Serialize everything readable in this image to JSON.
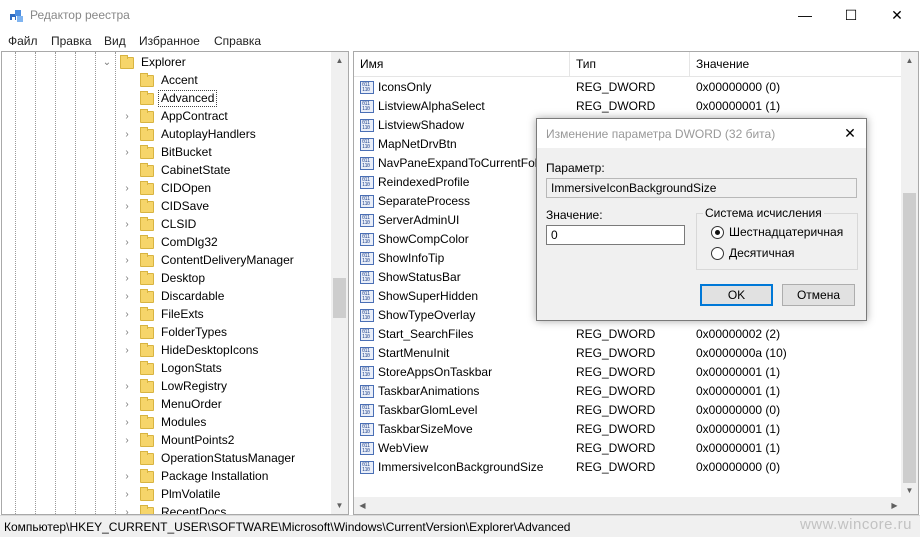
{
  "window": {
    "title": "Редактор реестра",
    "minimize": "—",
    "maximize": "☐",
    "close": "✕"
  },
  "menu": [
    "Файл",
    "Правка",
    "Вид",
    "Избранное",
    "Справка"
  ],
  "tree": {
    "parent": "Explorer",
    "selected": "Advanced",
    "items": [
      {
        "label": "Explorer",
        "expander": "⌄"
      },
      {
        "label": "Accent",
        "expander": ""
      },
      {
        "label": "Advanced",
        "expander": ""
      },
      {
        "label": "AppContract",
        "expander": "›"
      },
      {
        "label": "AutoplayHandlers",
        "expander": "›"
      },
      {
        "label": "BitBucket",
        "expander": "›"
      },
      {
        "label": "CabinetState",
        "expander": ""
      },
      {
        "label": "CIDOpen",
        "expander": "›"
      },
      {
        "label": "CIDSave",
        "expander": "›"
      },
      {
        "label": "CLSID",
        "expander": "›"
      },
      {
        "label": "ComDlg32",
        "expander": "›"
      },
      {
        "label": "ContentDeliveryManager",
        "expander": "›"
      },
      {
        "label": "Desktop",
        "expander": "›"
      },
      {
        "label": "Discardable",
        "expander": "›"
      },
      {
        "label": "FileExts",
        "expander": "›"
      },
      {
        "label": "FolderTypes",
        "expander": "›"
      },
      {
        "label": "HideDesktopIcons",
        "expander": "›"
      },
      {
        "label": "LogonStats",
        "expander": ""
      },
      {
        "label": "LowRegistry",
        "expander": "›"
      },
      {
        "label": "MenuOrder",
        "expander": "›"
      },
      {
        "label": "Modules",
        "expander": "›"
      },
      {
        "label": "MountPoints2",
        "expander": "›"
      },
      {
        "label": "OperationStatusManager",
        "expander": ""
      },
      {
        "label": "Package Installation",
        "expander": "›"
      },
      {
        "label": "PlmVolatile",
        "expander": "›"
      },
      {
        "label": "RecentDocs",
        "expander": "›"
      }
    ]
  },
  "list": {
    "headers": {
      "name": "Имя",
      "type": "Тип",
      "value": "Значение"
    },
    "rows": [
      {
        "name": "IconsOnly",
        "type": "REG_DWORD",
        "value": "0x00000000 (0)"
      },
      {
        "name": "ListviewAlphaSelect",
        "type": "REG_DWORD",
        "value": "0x00000001 (1)"
      },
      {
        "name": "ListviewShadow",
        "type": "",
        "value": ""
      },
      {
        "name": "MapNetDrvBtn",
        "type": "",
        "value": ""
      },
      {
        "name": "NavPaneExpandToCurrentFolder",
        "type": "",
        "value": ""
      },
      {
        "name": "ReindexedProfile",
        "type": "",
        "value": ""
      },
      {
        "name": "SeparateProcess",
        "type": "",
        "value": ""
      },
      {
        "name": "ServerAdminUI",
        "type": "",
        "value": ""
      },
      {
        "name": "ShowCompColor",
        "type": "",
        "value": ""
      },
      {
        "name": "ShowInfoTip",
        "type": "",
        "value": ""
      },
      {
        "name": "ShowStatusBar",
        "type": "",
        "value": ""
      },
      {
        "name": "ShowSuperHidden",
        "type": "",
        "value": ""
      },
      {
        "name": "ShowTypeOverlay",
        "type": "",
        "value": ""
      },
      {
        "name": "Start_SearchFiles",
        "type": "REG_DWORD",
        "value": "0x00000002 (2)"
      },
      {
        "name": "StartMenuInit",
        "type": "REG_DWORD",
        "value": "0x0000000a (10)"
      },
      {
        "name": "StoreAppsOnTaskbar",
        "type": "REG_DWORD",
        "value": "0x00000001 (1)"
      },
      {
        "name": "TaskbarAnimations",
        "type": "REG_DWORD",
        "value": "0x00000001 (1)"
      },
      {
        "name": "TaskbarGlomLevel",
        "type": "REG_DWORD",
        "value": "0x00000000 (0)"
      },
      {
        "name": "TaskbarSizeMove",
        "type": "REG_DWORD",
        "value": "0x00000001 (1)"
      },
      {
        "name": "WebView",
        "type": "REG_DWORD",
        "value": "0x00000001 (1)"
      },
      {
        "name": "ImmersiveIconBackgroundSize",
        "type": "REG_DWORD",
        "value": "0x00000000 (0)"
      }
    ]
  },
  "status": {
    "path": "Компьютер\\HKEY_CURRENT_USER\\SOFTWARE\\Microsoft\\Windows\\CurrentVersion\\Explorer\\Advanced",
    "watermark": "www.wincore.ru"
  },
  "dialog": {
    "title": "Изменение параметра DWORD (32 бита)",
    "close": "✕",
    "param_label": "Параметр:",
    "param_value": "ImmersiveIconBackgroundSize",
    "value_label": "Значение:",
    "value": "0",
    "base_label": "Система исчисления",
    "hex_label": "Шестнадцатеричная",
    "dec_label": "Десятичная",
    "base_selected": "hex",
    "ok": "OK",
    "cancel": "Отмена"
  },
  "colors": {
    "folder": "#f6d56a",
    "focus": "#0078d7",
    "chrome": "#f0f0f0"
  }
}
